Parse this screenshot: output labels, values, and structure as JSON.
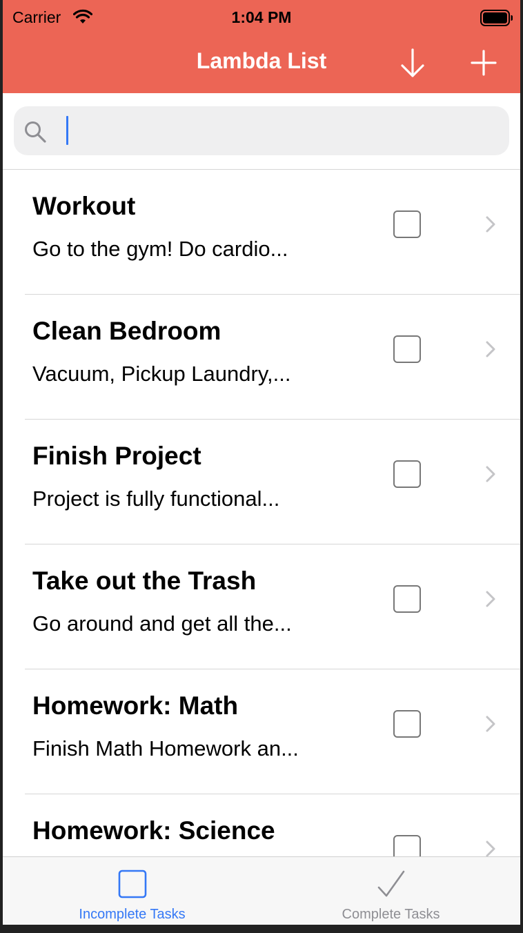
{
  "status_bar": {
    "carrier": "Carrier",
    "time": "1:04 PM"
  },
  "nav": {
    "title": "Lambda List",
    "sort_icon": "arrow-down-icon",
    "add_icon": "plus-icon"
  },
  "search": {
    "value": "",
    "placeholder": ""
  },
  "tasks": [
    {
      "title": "Workout",
      "description": "Go to the gym! Do cardio...",
      "completed": false
    },
    {
      "title": "Clean Bedroom",
      "description": "Vacuum, Pickup Laundry,...",
      "completed": false
    },
    {
      "title": "Finish Project",
      "description": "Project is fully functional...",
      "completed": false
    },
    {
      "title": "Take out the Trash",
      "description": "Go around and get all the...",
      "completed": false
    },
    {
      "title": "Homework: Math",
      "description": "Finish Math Homework an...",
      "completed": false
    },
    {
      "title": "Homework: Science",
      "description": "",
      "completed": false
    }
  ],
  "tab_bar": {
    "tabs": [
      {
        "label": "Incomplete Tasks",
        "icon": "square-icon",
        "selected": true
      },
      {
        "label": "Complete Tasks",
        "icon": "checkmark-icon",
        "selected": false
      }
    ]
  },
  "colors": {
    "accent": "#EC6555",
    "tint": "#3478F6",
    "inactive": "#8E8E93"
  }
}
